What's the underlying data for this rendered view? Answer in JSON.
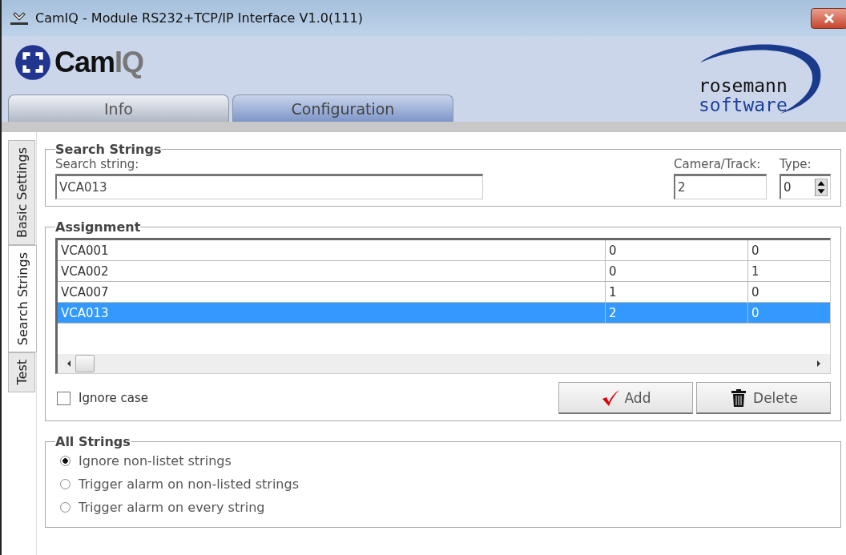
{
  "window": {
    "title": "CamIQ - Module RS232+TCP/IP Interface V1.0(111)"
  },
  "logo": {
    "main": "Cam",
    "accent": "IQ"
  },
  "brand": {
    "line1": "rosemann",
    "line2": "software"
  },
  "main_tabs": [
    {
      "label": "Info",
      "selected": false
    },
    {
      "label": "Configuration",
      "selected": true
    }
  ],
  "side_tabs": [
    {
      "label": "Basic Settings",
      "selected": false
    },
    {
      "label": "Search Strings",
      "selected": true
    },
    {
      "label": "Test",
      "selected": false
    }
  ],
  "search_strings": {
    "title": "Search Strings",
    "search_label": "Search string:",
    "search_value": "VCA013",
    "camera_label": "Camera/Track:",
    "camera_value": "2",
    "type_label": "Type:",
    "type_value": "0"
  },
  "assignment": {
    "title": "Assignment",
    "rows": [
      {
        "cells": [
          "VCA001",
          "0",
          "0"
        ],
        "selected": false
      },
      {
        "cells": [
          "VCA002",
          "0",
          "1"
        ],
        "selected": false
      },
      {
        "cells": [
          "VCA007",
          "1",
          "0"
        ],
        "selected": false
      },
      {
        "cells": [
          "VCA013",
          "2",
          "0"
        ],
        "selected": true
      }
    ],
    "ignore_case": {
      "label": "Ignore case",
      "checked": false
    },
    "buttons": [
      {
        "label": "Add",
        "kind": "add"
      },
      {
        "label": "Delete",
        "kind": "delete"
      }
    ]
  },
  "all_strings": {
    "title": "All Strings",
    "options": [
      {
        "label": "Ignore non-listet strings",
        "selected": true
      },
      {
        "label": "Trigger alarm on non-listed strings",
        "selected": false
      },
      {
        "label": "Trigger alarm on every string",
        "selected": false
      }
    ]
  }
}
